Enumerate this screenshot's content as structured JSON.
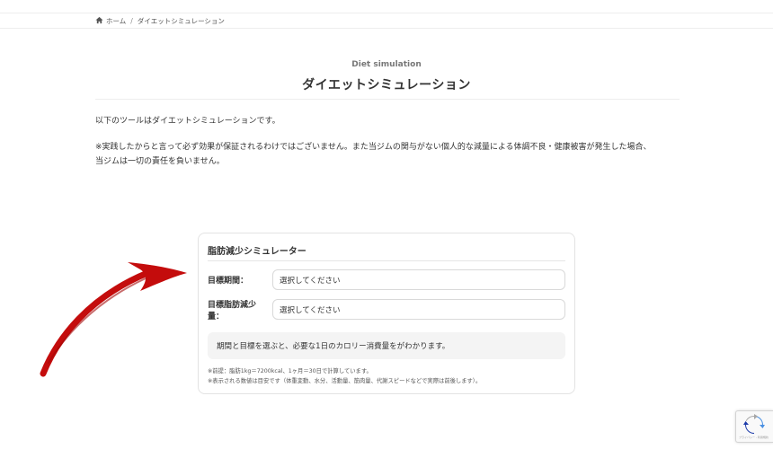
{
  "breadcrumb": {
    "home_label": "ホーム",
    "separator": "/",
    "current": "ダイエットシミュレーション"
  },
  "page": {
    "subtitle": "Diet simulation",
    "title": "ダイエットシミュレーション",
    "intro": "以下のツールはダイエットシミュレーションです。",
    "notice_line1": "※実践したからと言って必ず効果が保証されるわけではございません。また当ジムの関与がない個人的な減量による体調不良・健康被害が発生した場合、",
    "notice_line2": "当ジムは一切の責任を負いません。"
  },
  "simulator": {
    "title": "脂肪減少シミュレーター",
    "period_label": "目標期間：",
    "period_value": "選択してください",
    "fat_label_line1": "目標脂肪減少",
    "fat_label_line2": "量：",
    "fat_value": "選択してください",
    "result_text": "期間と目標を選ぶと、必要な1日のカロリー消費量をがわかります。",
    "note1": "※前提：脂肪1kg＝7200kcal、1ヶ月＝30日で計算しています。",
    "note2": "※表示される数値は目安です（体重変動、水分、活動量、筋肉量、代謝スピードなどで実際は前後します）。"
  },
  "recaptcha": {
    "text": "プライバシー - 利用規約"
  },
  "colors": {
    "arrow": "#c40c0c",
    "accent_text": "#333333",
    "recaptcha_blue": "#1c3aa9"
  },
  "icons": {
    "home": "home-icon",
    "arrow": "red-arrow-icon",
    "recaptcha": "recaptcha-icon"
  }
}
